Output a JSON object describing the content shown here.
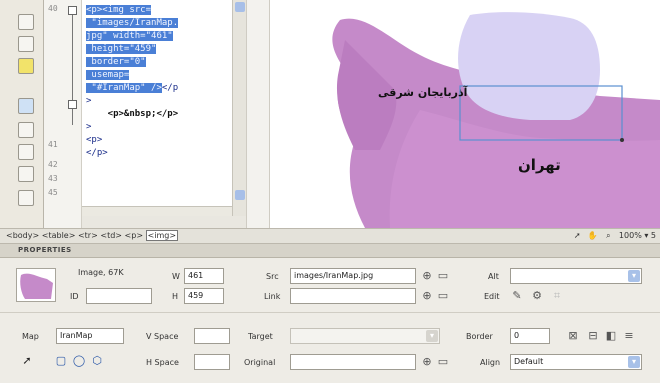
{
  "editor": {
    "line_numbers": [
      "40",
      "41",
      "42",
      "43",
      "45"
    ],
    "code_lines": [
      {
        "text": "<p><img src=",
        "selected": true
      },
      {
        "text": " \"images/IranMap.",
        "selected": true
      },
      {
        "text": "jpg\" width=\"461\"",
        "selected": true
      },
      {
        "text": " height=\"459\"",
        "selected": true
      },
      {
        "text": " border=\"0\"",
        "selected": true
      },
      {
        "text": " usemap=",
        "selected": true
      },
      {
        "text": " \"#IranMap\" />",
        "selected": true,
        "after": "</p"
      },
      {
        "text": ">",
        "selected": false
      },
      {
        "text": "    <p>&nbsp;</p>",
        "selected": false
      },
      {
        "text": ">",
        "selected": false
      },
      {
        "text": "<p>",
        "selected": false
      },
      {
        "text": "</p>",
        "selected": false
      }
    ]
  },
  "design": {
    "label_azerbaijan": "آذربایجان شرقی",
    "label_tehran": "تهران"
  },
  "statusbar": {
    "tag_path": [
      "<body>",
      "<table>",
      "<tr>",
      "<td>",
      "<p>"
    ],
    "current_tag": "<img>",
    "zoom": "100%",
    "extra": "5"
  },
  "properties": {
    "title": "PROPERTIES",
    "image_kind": "Image, 67K",
    "id_label": "ID",
    "id_value": "",
    "w_label": "W",
    "w_value": "461",
    "h_label": "H",
    "h_value": "459",
    "src_label": "Src",
    "src_value": "images/IranMap.jpg",
    "link_label": "Link",
    "link_value": "",
    "alt_label": "Alt",
    "alt_value": "",
    "edit_label": "Edit",
    "map_label": "Map",
    "map_value": "IranMap",
    "vspace_label": "V Space",
    "vspace_value": "",
    "target_label": "Target",
    "target_value": "",
    "border_label": "Border",
    "border_value": "0",
    "hspace_label": "H Space",
    "hspace_value": "",
    "original_label": "Original",
    "original_value": "",
    "align_label": "Align",
    "align_value": "Default"
  },
  "colors": {
    "selection": "#4a7fd6",
    "map_region": "#c58ac9",
    "map_highlight": "#d8d2f4",
    "hotspot_border": "#5a8fd0"
  }
}
